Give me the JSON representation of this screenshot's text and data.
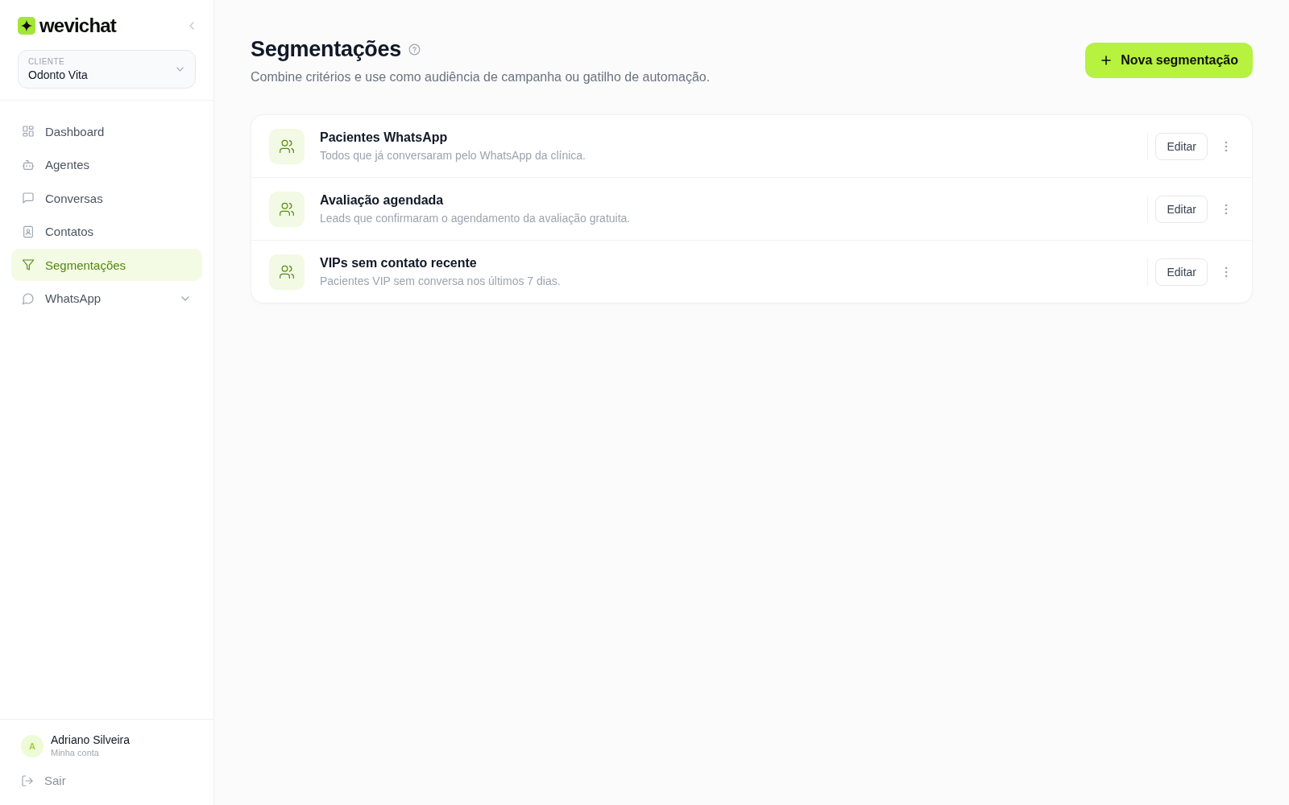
{
  "sidebar": {
    "logo": {
      "text": "wevichat"
    },
    "client": {
      "label": "CLIENTE",
      "value": "Odonto Vita"
    },
    "nav": [
      {
        "label": "Dashboard",
        "selected": false,
        "kind": "link"
      },
      {
        "label": "Agentes",
        "selected": false,
        "kind": "link"
      },
      {
        "label": "Conversas",
        "selected": false,
        "kind": "link"
      },
      {
        "label": "Contatos",
        "selected": false,
        "kind": "link"
      },
      {
        "label": "Segmentações",
        "selected": true,
        "kind": "link"
      },
      {
        "label": "WhatsApp",
        "selected": false,
        "kind": "group",
        "expanded": false
      }
    ],
    "user": {
      "initial": "A",
      "name": "Adriano Silveira",
      "subtitle": "Minha conta"
    },
    "logout": "Sair"
  },
  "header": {
    "title": "Segmentações",
    "subtitle": "Combine critérios e use como audiência de campanha ou gatilho de automação.",
    "new_button": "Nova segmentação"
  },
  "segments": [
    {
      "name": "Pacientes WhatsApp",
      "description": "Todos que já conversaram pelo WhatsApp da clínica.",
      "edit_label": "Editar"
    },
    {
      "name": "Avaliação agendada",
      "description": "Leads que confirmaram o agendamento da avaliação gratuita.",
      "edit_label": "Editar"
    },
    {
      "name": "VIPs sem contato recente",
      "description": "Pacientes VIP sem conversa nos últimos 7 dias.",
      "edit_label": "Editar"
    }
  ]
}
